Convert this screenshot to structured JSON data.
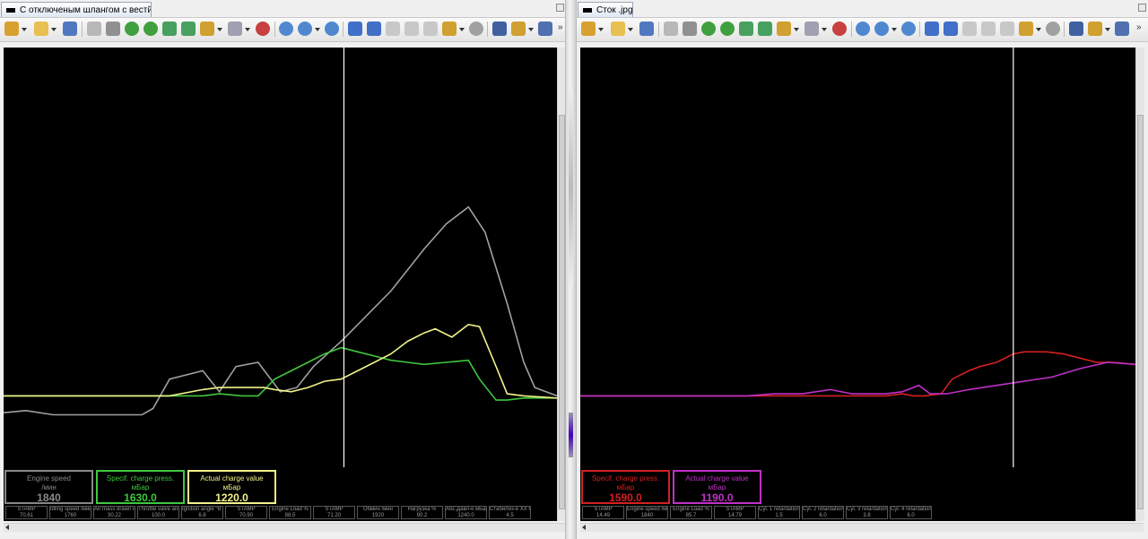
{
  "left": {
    "tab_title": "С отключеным шлангом с вестй гей...",
    "toolbar_more": "»",
    "chart_data": {
      "type": "line",
      "xlim": [
        0,
        100
      ],
      "ylim": [
        0,
        100
      ],
      "cursor_x": 61.5,
      "series": [
        {
          "name": "Engine speed",
          "color": "#a0a0a0",
          "x": [
            0,
            4,
            9,
            25,
            27,
            30,
            36,
            39,
            42,
            46,
            50,
            53,
            56,
            61,
            64,
            67,
            70,
            73,
            76,
            80,
            84,
            87,
            91,
            94,
            96,
            100
          ],
          "y": [
            13,
            13.5,
            12.5,
            12.5,
            14,
            21,
            23,
            18,
            24,
            25,
            18,
            19,
            24,
            30,
            34,
            38,
            42,
            47,
            52,
            58,
            62,
            56,
            39,
            25,
            19,
            17
          ]
        },
        {
          "name": "Specif. charge press.",
          "color": "#3ec83e",
          "x": [
            0,
            10,
            20,
            30,
            36,
            39,
            43,
            46,
            49,
            52,
            55,
            58,
            61,
            64,
            67,
            70,
            73,
            76,
            80,
            84,
            86,
            89,
            91,
            94,
            100
          ],
          "y": [
            17,
            17,
            17,
            17,
            17,
            17.5,
            17,
            17,
            21,
            23,
            25,
            27,
            28.5,
            27.5,
            26.5,
            25.5,
            25,
            24.5,
            25,
            25.5,
            21,
            16,
            16,
            16.5,
            16.5
          ]
        },
        {
          "name": "Actual charge value",
          "color": "#f2f28a",
          "x": [
            0,
            10,
            20,
            30,
            36,
            39,
            43,
            47,
            49,
            52,
            55,
            58,
            61,
            64,
            67,
            70,
            73,
            76,
            78,
            81,
            84,
            86,
            89,
            91,
            94,
            100
          ],
          "y": [
            17,
            17,
            17,
            17,
            18.5,
            19,
            19,
            19,
            18.5,
            18,
            19,
            20.5,
            21,
            23,
            25,
            27,
            30,
            32,
            33,
            31,
            34,
            33.5,
            24,
            17.5,
            17,
            16.5
          ]
        }
      ]
    },
    "gauges": [
      {
        "name": "Engine speed",
        "unit": "/мин",
        "value": "1840",
        "color": "#888888"
      },
      {
        "name": "Specif. charge press.",
        "unit": "мБар",
        "value": "1630.0",
        "color": "#3ec83e"
      },
      {
        "name": "Actual charge value",
        "unit": "мБар",
        "value": "1220.0",
        "color": "#f2f28a"
      }
    ],
    "cells": [
      {
        "name": "STAMP",
        "value": "70.61"
      },
      {
        "name": "Idling speed /мин",
        "value": "1760"
      },
      {
        "name": "Air mass drawn in ...",
        "value": "30.22"
      },
      {
        "name": "Throttle valve angl...",
        "value": "100.0"
      },
      {
        "name": "Ignition angle °BT...",
        "value": "6.8"
      },
      {
        "name": "STAMP",
        "value": "70.90"
      },
      {
        "name": "Engine Load %",
        "value": "88.5"
      },
      {
        "name": "STAMP",
        "value": "71.20"
      },
      {
        "name": "Обмин /мин",
        "value": "1920"
      },
      {
        "name": "Нагрузка %",
        "value": "90.2"
      },
      {
        "name": "Абс.Давл-е мБар",
        "value": "1240.0"
      },
      {
        "name": "Стабилиз-е ХХ СР",
        "value": "4.5"
      }
    ]
  },
  "right": {
    "tab_title": "Сток .jpg",
    "toolbar_more": "»",
    "chart_data": {
      "type": "line",
      "xlim": [
        0,
        100
      ],
      "ylim": [
        0,
        100
      ],
      "cursor_x": 78,
      "series": [
        {
          "name": "Specif. charge press.",
          "color": "#d42020",
          "x": [
            0,
            20,
            40,
            50,
            52,
            55,
            58,
            60,
            62,
            65,
            67,
            70,
            72,
            75,
            78,
            80,
            84,
            87,
            90,
            93,
            96,
            100
          ],
          "y": [
            17,
            17,
            17,
            17,
            17,
            17,
            17.5,
            17,
            17,
            17.5,
            21,
            23,
            24,
            25,
            27,
            27.5,
            27.5,
            27,
            26,
            25,
            25,
            24.5
          ]
        },
        {
          "name": "Actual charge value",
          "color": "#c030c8",
          "x": [
            0,
            10,
            20,
            30,
            35,
            40,
            45,
            49,
            52,
            55,
            58,
            61,
            63,
            66,
            70,
            75,
            80,
            85,
            90,
            95,
            100
          ],
          "y": [
            17,
            17,
            17,
            17,
            17.5,
            17.5,
            18.5,
            17.5,
            17.5,
            17.5,
            18,
            19.5,
            17.5,
            17.5,
            18.5,
            19.5,
            20.5,
            21.5,
            23.5,
            25,
            24.5
          ]
        }
      ]
    },
    "gauges": [
      {
        "name": "Specif. charge press.",
        "unit": "мБар",
        "value": "1590.0",
        "color": "#d42020"
      },
      {
        "name": "Actual charge value",
        "unit": "мБар",
        "value": "1190.0",
        "color": "#c030c8"
      }
    ],
    "cells": [
      {
        "name": "STAMP",
        "value": "14.49"
      },
      {
        "name": "Engine speed /мин",
        "value": "1840"
      },
      {
        "name": "Engine Load %",
        "value": "85.7"
      },
      {
        "name": "STAMP",
        "value": "14.79"
      },
      {
        "name": "Cyl. 1 retardation ...",
        "value": "1.5"
      },
      {
        "name": "Cyl. 2 retardation ...",
        "value": "6.0"
      },
      {
        "name": "Cyl. 3 retardation ...",
        "value": "3.8"
      },
      {
        "name": "Cyl. 4 retardation ...",
        "value": "6.0"
      }
    ]
  }
}
